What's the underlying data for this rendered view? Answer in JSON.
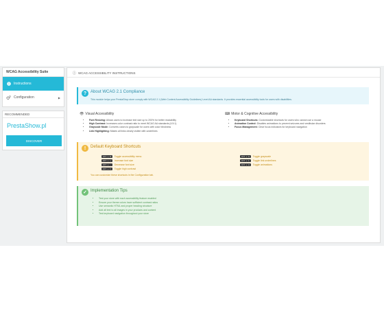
{
  "sidebar": {
    "title": "WCAG Accessibility Suite",
    "items": [
      {
        "label": "Instructions",
        "icon": "info-icon",
        "active": true
      },
      {
        "label": "Configuration",
        "icon": "gears-icon",
        "active": false
      }
    ]
  },
  "recommended": {
    "title": "RECOMMENDED",
    "logo_text": "PrestaShow.pl",
    "button": "DISCOVER"
  },
  "main": {
    "header": "WCAG ACCESSIBILITY INSTRUCTIONS",
    "about": {
      "title": "About WCAG 2.1 Compliance",
      "text": "This module helps your PrestaShop store comply with WCAG 2.1 (Web Content Accessibility Guidelines) Level AA standards. It provides essential accessibility tools for users with disabilities."
    },
    "visual": {
      "title": "Visual Accessibility",
      "items": [
        {
          "term": "Font Resizing:",
          "desc": "Allows users to increase text size up to 200% for better readability"
        },
        {
          "term": "High Contrast:",
          "desc": "Increases color contrast ratio to meet WCAG AA standards (4.5:1)"
        },
        {
          "term": "Grayscale Mode:",
          "desc": "Converts colors to grayscale for users with color blindness"
        },
        {
          "term": "Link Highlighting:",
          "desc": "Makes all links clearly visible with underlines"
        }
      ]
    },
    "motor": {
      "title": "Motor & Cognitive Accessibility",
      "items": [
        {
          "term": "Keyboard Shortcuts:",
          "desc": "Customizable shortcuts for users who cannot use a mouse"
        },
        {
          "term": "Animation Control:",
          "desc": "Disables animations to prevent seizures and vestibular disorders"
        },
        {
          "term": "Focus Management:",
          "desc": "Clear focus indicators for keyboard navigation"
        }
      ]
    },
    "shortcuts": {
      "title": "Default Keyboard Shortcuts",
      "left": [
        {
          "keys": "Alt + 0",
          "label": "Toggle accessibility menu"
        },
        {
          "keys": "Alt + +",
          "label": "Increase font size"
        },
        {
          "keys": "Alt + -",
          "label": "Decrease font size"
        },
        {
          "keys": "Alt + C",
          "label": "Toggle high contrast"
        }
      ],
      "right": [
        {
          "keys": "Alt + G",
          "label": "Toggle grayscale"
        },
        {
          "keys": "Alt + L",
          "label": "Toggle link underlines"
        },
        {
          "keys": "Alt + A",
          "label": "Toggle animations"
        }
      ],
      "note": "You can customize these shortcuts in the Configuration tab."
    },
    "tips": {
      "title": "Implementation Tips",
      "items": [
        "Test your store with each accessibility feature enabled",
        "Ensure your theme colors have sufficient contrast ratios",
        "Use semantic HTML and proper heading structure",
        "Add alt text to all images in your products and content",
        "Test keyboard navigation throughout your store"
      ]
    }
  },
  "colors": {
    "accent": "#25b9d7",
    "warning": "#f0b941",
    "success": "#72c279"
  }
}
